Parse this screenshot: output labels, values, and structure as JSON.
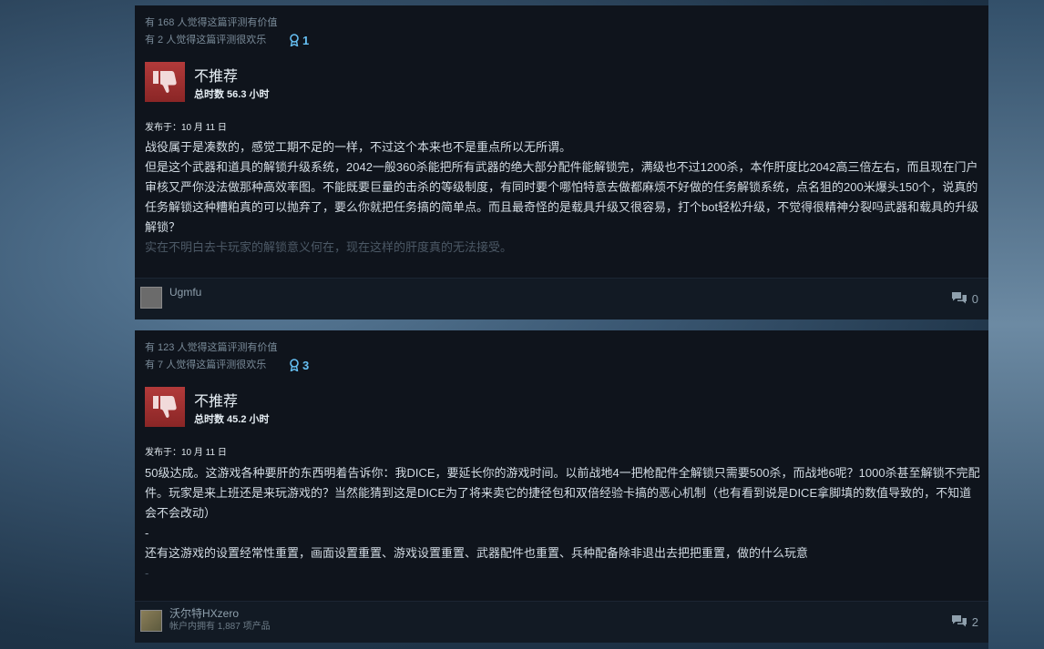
{
  "reviews": [
    {
      "helpful_text": "有 168 人觉得这篇评测有价值",
      "funny_text": "有 2 人觉得这篇评测很欢乐",
      "award_count": "1",
      "verdict": "不推荐",
      "hours": "总时数 56.3 小时",
      "posted": "发布于：10 月 11 日",
      "paragraphs": [
        "战役属于是凑数的，感觉工期不足的一样，不过这个本来也不是重点所以无所谓。",
        "但是这个武器和道具的解锁升级系统，2042一般360杀能把所有武器的绝大部分配件能解锁完，满级也不过1200杀，本作肝度比2042高三倍左右，而且现在门户审核又严你没法做那种高效率图。不能既要巨量的击杀的等级制度，有同时要个哪怕特意去做都麻烦不好做的任务解锁系统，点名狙的200米爆头150个，说真的任务解锁这种糟粕真的可以抛弃了，要么你就把任务搞的简单点。而且最奇怪的是载具升级又很容易，打个bot轻松升级，不觉得很精神分裂吗武器和载具的升级解锁？",
        "实在不明白去卡玩家的解锁意义何在，现在这样的肝度真的无法接受。"
      ],
      "username": "Ugmfu",
      "comment_count": "0"
    },
    {
      "helpful_text": "有 123 人觉得这篇评测有价值",
      "funny_text": "有 7 人觉得这篇评测很欢乐",
      "award_count": "3",
      "verdict": "不推荐",
      "hours": "总时数 45.2 小时",
      "posted": "发布于：10 月 11 日",
      "paragraphs": [
        "50级达成。这游戏各种要肝的东西明着告诉你：我DICE，要延长你的游戏时间。以前战地4一把枪配件全解锁只需要500杀，而战地6呢？1000杀甚至解锁不完配件。玩家是来上班还是来玩游戏的？当然能猜到这是DICE为了将来卖它的捷径包和双倍经验卡搞的恶心机制（也有看到说是DICE拿脚填的数值导致的，不知道会不会改动）",
        "-",
        "还有这游戏的设置经常性重置，画面设置重置、游戏设置重置、武器配件也重置、兵种配备除非退出去把把重置，做的什么玩意",
        "-"
      ],
      "username": "沃尔特HXzero",
      "user_sub": "帐户内拥有 1,887 项产品",
      "comment_count": "2"
    }
  ]
}
